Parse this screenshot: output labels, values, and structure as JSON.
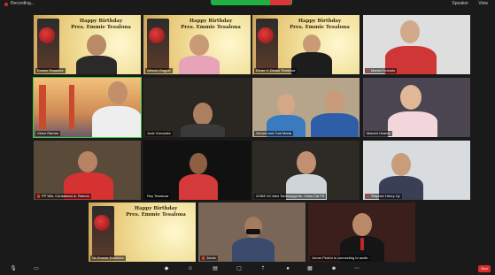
{
  "topbar": {
    "recording_label": "Recording...",
    "share_banner": "You are viewing Screen",
    "view_label": "View",
    "speaker_label": "Speaker"
  },
  "birthday_card": {
    "line1": "Happy Birthday",
    "line2": "Pres. Emmie Tesalona"
  },
  "participants": [
    {
      "name": "Emmie Tesalona"
    },
    {
      "name": "Alfredo Ongpin"
    },
    {
      "name": "Elmer Y. Dimas Tesalona"
    },
    {
      "name": "Marita Eruzado"
    },
    {
      "name": "Victor Ramos"
    },
    {
      "name": "Jude Gonzales"
    },
    {
      "name": "Gerard and Tuni Maria"
    },
    {
      "name": "Maricel Ubaldo"
    },
    {
      "name": "PP Wis. Constancio A. Ramos"
    },
    {
      "name": "Rey Tesalona"
    },
    {
      "name": "ZONE 4C Alen Tanbuyaga Ac. Cans Cal FS"
    },
    {
      "name": "Stephen Henry Uy"
    },
    {
      "name": "Sir Emmie Tesalona"
    },
    {
      "name": "Jones"
    },
    {
      "name": "Jomar Pedrio is connecting to audio"
    }
  ],
  "toolbar": {
    "end_label": "End"
  },
  "colors": {
    "active_outline": "#3ec93e",
    "mic_off": "#e33333",
    "end_button": "#d92c2c"
  }
}
